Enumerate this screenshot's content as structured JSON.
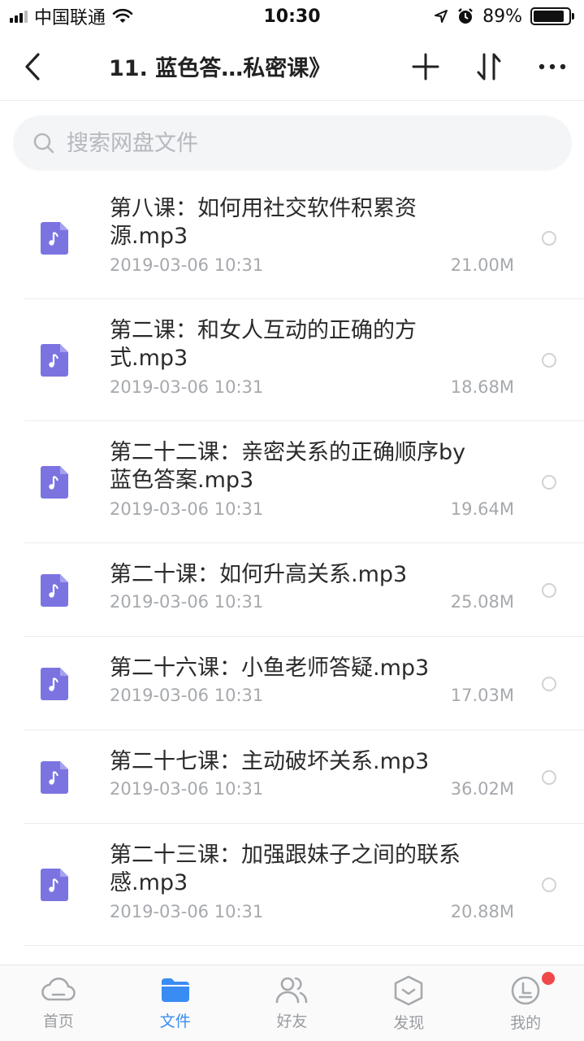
{
  "status_bar": {
    "carrier": "中国联通",
    "time": "10:30",
    "battery": "89%",
    "battery_level": 0.89
  },
  "nav": {
    "title": "11. 蓝色答…私密课》"
  },
  "search": {
    "placeholder": "搜索网盘文件"
  },
  "files": [
    {
      "name": "第八课：如何用社交软件积累资源.mp3",
      "date": "2019-03-06 10:31",
      "size": "21.00M"
    },
    {
      "name": "第二课：和女人互动的正确的方式.mp3",
      "date": "2019-03-06 10:31",
      "size": "18.68M"
    },
    {
      "name": "第二十二课：亲密关系的正确顺序by蓝色答案.mp3",
      "date": "2019-03-06 10:31",
      "size": "19.64M"
    },
    {
      "name": "第二十课：如何升高关系.mp3",
      "date": "2019-03-06 10:31",
      "size": "25.08M"
    },
    {
      "name": "第二十六课：小鱼老师答疑.mp3",
      "date": "2019-03-06 10:31",
      "size": "17.03M"
    },
    {
      "name": "第二十七课：主动破坏关系.mp3",
      "date": "2019-03-06 10:31",
      "size": "36.02M"
    },
    {
      "name": "第二十三课：加强跟妹子之间的联系感.mp3",
      "date": "2019-03-06 10:31",
      "size": "20.88M"
    }
  ],
  "tabs": [
    {
      "label": "首页",
      "icon": "cloud-icon"
    },
    {
      "label": "文件",
      "icon": "folder-icon"
    },
    {
      "label": "好友",
      "icon": "friends-icon"
    },
    {
      "label": "发现",
      "icon": "discover-icon"
    },
    {
      "label": "我的",
      "icon": "profile-icon"
    }
  ],
  "colors": {
    "accent": "#3a8cf5",
    "file_icon": "#7b74e0",
    "badge": "#f04848"
  }
}
